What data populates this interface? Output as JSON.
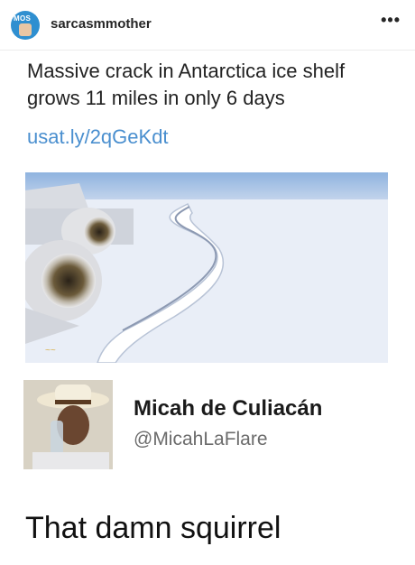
{
  "post": {
    "username": "sarcasmmother",
    "avatar_badge": "MOS",
    "more_icon": "more-horizontal-icon",
    "more_glyph": "•••"
  },
  "article": {
    "headline": "Massive crack in Antarctica ice shelf grows 11 miles in only 6 days",
    "link": "usat.ly/2qGeKdt"
  },
  "tweet": {
    "display_name": "Micah de Culiacán",
    "handle": "@MicahLaFlare",
    "text": "That damn squirrel"
  },
  "colors": {
    "link": "#4a8fcf",
    "handle": "#6b6b6b",
    "avatar_bg": "#2f8fd0"
  }
}
